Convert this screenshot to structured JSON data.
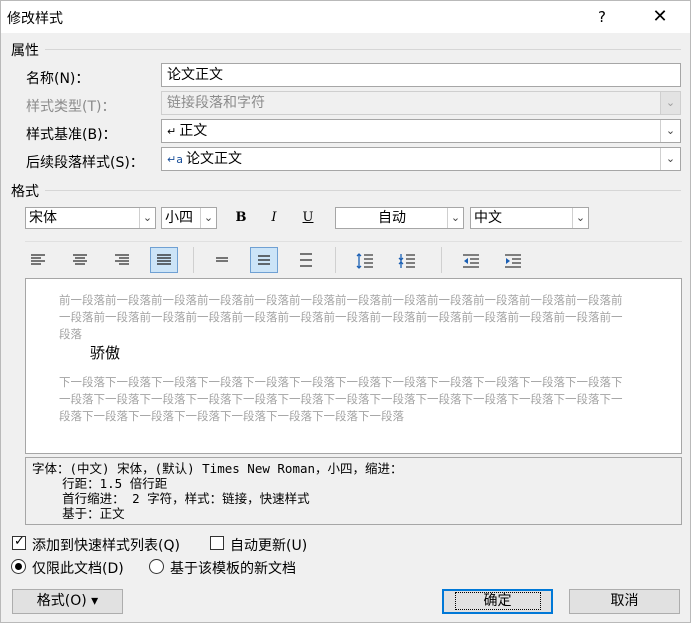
{
  "dialog": {
    "title": "修改样式",
    "help_label": "?",
    "close_label": "✕"
  },
  "properties": {
    "section_label": "属性",
    "name": {
      "label": "名称(N)：",
      "value": "论文正文"
    },
    "style_type": {
      "label": "样式类型(T)：",
      "value": "链接段落和字符"
    },
    "based_on": {
      "label": "样式基准(B)：",
      "value": "正文",
      "icon": "paragraph-mark-icon"
    },
    "next_style": {
      "label": "后续段落样式(S)：",
      "value": "论文正文",
      "icon": "linked-style-icon"
    }
  },
  "format": {
    "section_label": "格式",
    "font": "宋体",
    "size": "小四",
    "bold": "B",
    "italic": "I",
    "underline": "U",
    "color": "自动",
    "script": "中文"
  },
  "preview": {
    "previous_paragraph": "前一段落前一段落前一段落前一段落前一段落前一段落前一段落前一段落前一段落前一段落前一段落前一段落前一段落前一段落前一段落前一段落前一段落前一段落前一段落前一段落前一段落前一段落前一段落前一段落前一段落",
    "sample_text": "骄傲",
    "next_paragraph": "下一段落下一段落下一段落下一段落下一段落下一段落下一段落下一段落下一段落下一段落下一段落下一段落下一段落下一段落下一段落下一段落下一段落下一段落下一段落下一段落下一段落下一段落下一段落下一段落下一段落下一段落下一段落下一段落下一段落下一段落下一段落下一段落"
  },
  "description": "字体：(中文) 宋体，(默认) Times New Roman，小四，缩进：\n    行距：1.5 倍行距\n    首行缩进： 2 字符，样式：链接，快速样式\n    基于：正文",
  "options": {
    "add_to_quick_styles": {
      "label": "添加到快速样式列表(Q)",
      "checked": true
    },
    "auto_update": {
      "label": "自动更新(U)",
      "checked": false
    },
    "only_this_document": {
      "label": "仅限此文档(D)",
      "selected": true
    },
    "new_documents_template": {
      "label": "基于该模板的新文档",
      "selected": false
    }
  },
  "buttons": {
    "format": "格式(O) ▾",
    "ok": "确定",
    "cancel": "取消"
  },
  "colors": {
    "accent": "#0078d7",
    "active_toggle": "#cce4f7",
    "preview_grey": "#a3a3a3"
  }
}
